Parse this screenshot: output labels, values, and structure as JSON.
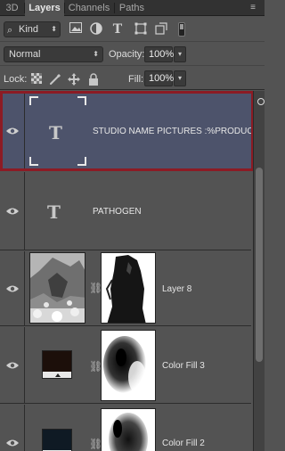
{
  "tabs": [
    {
      "label": "3D"
    },
    {
      "label": "Layers"
    },
    {
      "label": "Channels"
    },
    {
      "label": "Paths"
    }
  ],
  "filter": {
    "kind_label": "Kind",
    "icons": [
      "pixel-filter-icon",
      "adjustment-filter-icon",
      "type-filter-icon",
      "shape-filter-icon",
      "smart-object-filter-icon"
    ]
  },
  "blending": {
    "mode": "Normal",
    "opacity_label": "Opacity:",
    "opacity_value": "100%"
  },
  "lock": {
    "label": "Lock:",
    "fill_label": "Fill:",
    "fill_value": "100%"
  },
  "layers": [
    {
      "name": "STUDIO NAME PICTURES :%PRODUC...",
      "type": "text",
      "selected": true
    },
    {
      "name": "PATHOGEN",
      "type": "text",
      "selected": false
    },
    {
      "name": "Layer 8",
      "type": "pixel-with-mask",
      "selected": false
    },
    {
      "name": "Color Fill 3",
      "type": "fill-with-mask",
      "selected": false
    },
    {
      "name": "Color Fill 2",
      "type": "fill-with-mask",
      "selected": false
    }
  ],
  "colors": {
    "panel_bg": "#535353",
    "selected_bg": "#4d536b",
    "highlight_frame": "#8c1b24",
    "tabbar_bg": "#323232"
  },
  "glyphs": {
    "type_glyph": "T",
    "link": "⛓",
    "search": "⌕",
    "updown": "⬍",
    "dropdown": "▾",
    "menu": "≡"
  }
}
